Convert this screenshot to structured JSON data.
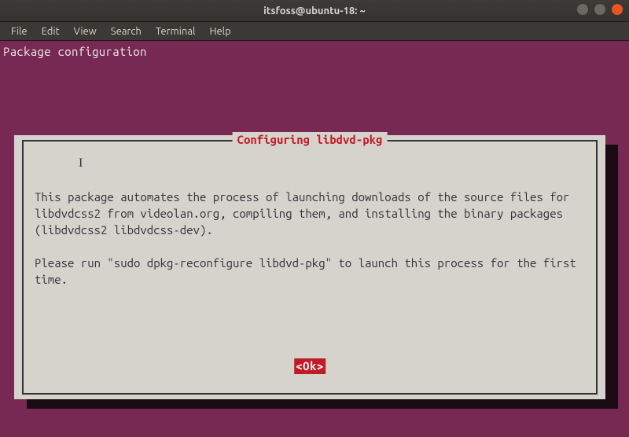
{
  "window": {
    "title": "itsfoss@ubuntu-18: ~"
  },
  "menubar": {
    "items": [
      "File",
      "Edit",
      "View",
      "Search",
      "Terminal",
      "Help"
    ]
  },
  "terminal": {
    "header": "Package configuration"
  },
  "dialog": {
    "title": " Configuring libdvd-pkg ",
    "body": "This package automates the process of launching downloads of the source files for libdvdcss2 from videolan.org, compiling them, and installing the binary packages (libdvdcss2 libdvdcss-dev).\n\nPlease run \"sudo dpkg-reconfigure libdvd-pkg\" to launch this process for the first time.",
    "ok_label": "<Ok>"
  }
}
